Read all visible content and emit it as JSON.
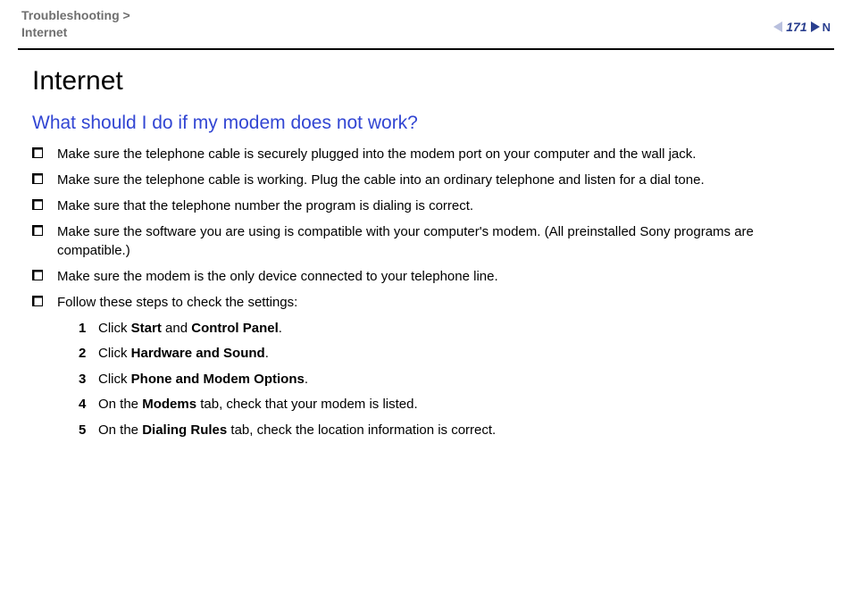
{
  "header": {
    "breadcrumb_parent": "Troubleshooting",
    "breadcrumb_sep": " >",
    "breadcrumb_child": "Internet",
    "page_number": "171",
    "nav_letter": "N"
  },
  "main": {
    "title": "Internet",
    "question": "What should I do if my modem does not work?",
    "bullets": [
      "Make sure the telephone cable is securely plugged into the modem port on your computer and the wall jack.",
      "Make sure the telephone cable is working. Plug the cable into an ordinary telephone and listen for a dial tone.",
      "Make sure that the telephone number the program is dialing is correct.",
      "Make sure the software you are using is compatible with your computer's modem. (All preinstalled Sony programs are compatible.)",
      "Make sure the modem is the only device connected to your telephone line.",
      "Follow these steps to check the settings:"
    ],
    "steps": [
      {
        "n": "1",
        "pre": "Click ",
        "b1": "Start",
        "mid": " and ",
        "b2": "Control Panel",
        "post": "."
      },
      {
        "n": "2",
        "pre": "Click ",
        "b1": "Hardware and Sound",
        "mid": "",
        "b2": "",
        "post": "."
      },
      {
        "n": "3",
        "pre": "Click ",
        "b1": "Phone and Modem Options",
        "mid": "",
        "b2": "",
        "post": "."
      },
      {
        "n": "4",
        "pre": "On the ",
        "b1": "Modems",
        "mid": " tab, check that your modem is listed.",
        "b2": "",
        "post": ""
      },
      {
        "n": "5",
        "pre": "On the ",
        "b1": "Dialing Rules",
        "mid": " tab, check the location information is correct.",
        "b2": "",
        "post": ""
      }
    ]
  }
}
